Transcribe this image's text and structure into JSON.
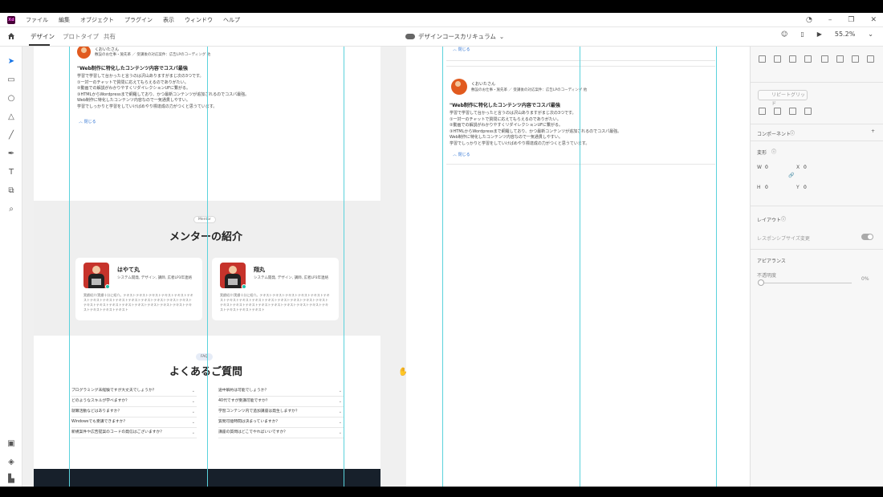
{
  "menubar": {
    "logo": "Xd",
    "items": [
      "ファイル",
      "編集",
      "オブジェクト",
      "プラグイン",
      "表示",
      "ウィンドウ",
      "ヘルプ"
    ]
  },
  "tabbar": {
    "tabs": [
      "デザイン",
      "プロトタイプ",
      "共有"
    ],
    "active_tab": "デザイン",
    "document_title": "デザインコースカリキュラム",
    "zoom": "55.2%"
  },
  "artboard_left": {
    "author_name": "くおいたさん",
    "author_role": "敷設のお仕事・施先革 ／ 受講後の対応案件：広告LPのコーディング 他",
    "headline": "\"Web制作に特化したコンテンツ内容でコスパ最強",
    "body_lines": [
      "学習で学習して台かったと言うのは沢山ありますがまじ次の3つです。",
      "①一対一のチャットで質問に応えてもらえるのでありがたい。",
      "②動画での解説がわかりやすくリダイレクションUFに繋がる。",
      "③HTMLからWordpressまで網羅しており、かつ最新コンテンツが追加されるのでコスパ最強。",
      "Web制作に特化したコンテンツ内容なので一気通貫しやすい。",
      "学習でしっかりと学習をしていけばめやり標達成の力がつくと思うています。"
    ],
    "close_link": "閉じる",
    "mentor_section": {
      "pill": "Mentor",
      "title": "メンターの紹介",
      "mentors": [
        {
          "name": "はやて丸",
          "skills": "システム開発, デザイン, 講師, 広者LP3年連絡",
          "bio": "実績紹介/実績十分に紹介。テキストテキストテキストテキストテキストテキストテキストテキストテキストテキストテキストテキストテキストテキストテキストテキストテキストテキストテキストテキストテキストテキストテキストテキストテキストテキスト"
        },
        {
          "name": "翔丸",
          "skills": "システム開発, デザイン, 講師, 広者LP3年連絡",
          "bio": "実績紹介/実績十分に紹介。テキストテキストテキストテキストテキストテキストテキストテキストテキストテキストテキストテキストテキストテキストテキストテキストテキストテキストテキストテキストテキストテキストテキストテキストテキストテキスト"
        }
      ]
    },
    "faq_section": {
      "pill": "FAQ",
      "title": "よくあるご質問",
      "left_questions": [
        "プログラミング未経験ですが大丈夫でしょうか？",
        "どのようなスキルが学べますか？",
        "就職活動などはありますか？",
        "Windowsでも受講できますか？",
        "新規案件や広告提案のコードの発信はございますか？"
      ],
      "right_questions": [
        "途中解約は可能でしょうか？",
        "40代ですが受講可能ですか？",
        "学習コンテンツ内で追加講座は発生しますか？",
        "質問可能時間は決まっていますか？",
        "講座の質問はどこでやればいいですか？"
      ]
    }
  },
  "artboard_right": {
    "close_link_top": "閉じる",
    "author_name": "くおいたさん",
    "author_role": "敷設のお仕事・施先革 ／ 受講後の対応案件：広告LPのコーディング 他",
    "headline": "\"Web制作に特化したコンテンツ内容でコスパ最強",
    "body_lines": [
      "学習で学習して台かったと言うのは沢山ありますがまじ次の3つです。",
      "①一対一のチャットで質問に応えてもらえるのでありがたい。",
      "②動画での解説がわかりやすくリダイレクションUFに繋がる。",
      "③HTMLからWordpressまで網羅しており、かつ最新コンテンツが追加されるのでコスパ最強。",
      "Web制作に特化したコンテンツ内容なので一気通貫しやすい。",
      "学習でしっかりと学習をしていけばめやり標達成の力がつくと思うています。"
    ],
    "close_link": "閉じる"
  },
  "right_panel": {
    "repeat_grid": "リピートグリッド",
    "component_label": "コンポーネント",
    "transform_label": "変形",
    "w_label": "W",
    "w_value": "0",
    "x_label": "X",
    "x_value": "0",
    "h_label": "H",
    "h_value": "0",
    "y_label": "Y",
    "y_value": "0",
    "layout_label": "レイアウト",
    "responsive_label": "レスポンシブサイズ変更",
    "appearance_label": "アピアランス",
    "opacity_label": "不透明度",
    "opacity_value": "0%"
  },
  "colors": {
    "guide": "#5ad2dc",
    "xd_brand": "#470137",
    "link": "#3a7bd5",
    "footer": "#17202b"
  }
}
